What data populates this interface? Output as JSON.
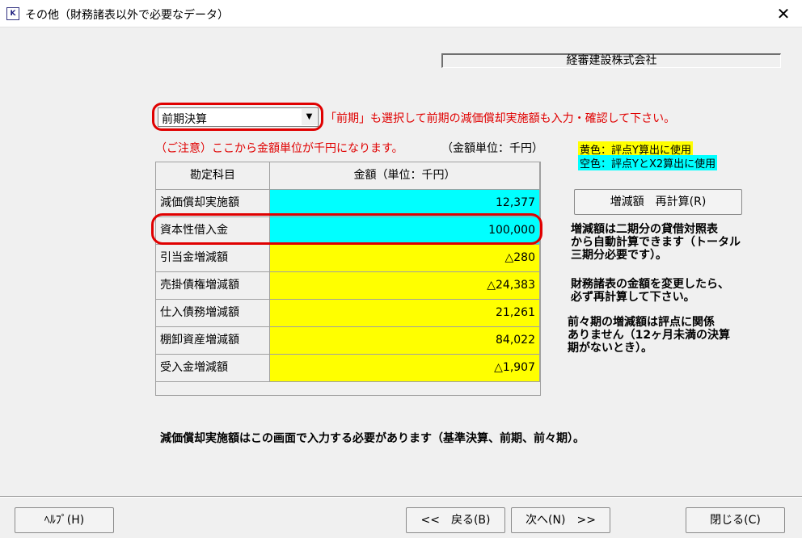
{
  "window": {
    "title": "その他（財務諸表以外で必要なデータ）",
    "close_label": "✕"
  },
  "company_name": "経審建設株式会社",
  "period_select": {
    "value": "前期決算"
  },
  "notice": "「前期」も選択して前期の減価償却実施額も入力・確認して下さい。",
  "caution": "（ご注意）ここから金額単位が千円になります。",
  "unit_label": "（金額単位：千円）",
  "legend": {
    "yellow": "黄色：評点Y算出に使用",
    "cyan": "空色：評点YとX2算出に使用"
  },
  "table": {
    "headers": [
      "勘定科目",
      "金額（単位：千円）"
    ],
    "rows": [
      {
        "label": "減価償却実施額",
        "value": "12,377",
        "color": "#00ffff"
      },
      {
        "label": "資本性借入金",
        "value": "100,000",
        "color": "#00ffff"
      },
      {
        "label": "引当金増減額",
        "value": "△280",
        "color": "#ffff00"
      },
      {
        "label": "売掛債権増減額",
        "value": "△24,383",
        "color": "#ffff00"
      },
      {
        "label": "仕入債務増減額",
        "value": "21,261",
        "color": "#ffff00"
      },
      {
        "label": "棚卸資産増減額",
        "value": "84,022",
        "color": "#ffff00"
      },
      {
        "label": "受入金増減額",
        "value": "△1,907",
        "color": "#ffff00"
      }
    ]
  },
  "recalc_button": "増減額　再計算(R)",
  "help": {
    "p1": [
      "増減額は二期分の貸借対照表",
      "から自動計算できます（トータル",
      "三期分必要です）。"
    ],
    "p2": [
      "財務諸表の金額を変更したら、",
      "必ず再計算して下さい。"
    ],
    "p3": [
      "前々期の増減額は評点に関係",
      "ありません（12ヶ月未満の決算",
      "期がないとき）。"
    ]
  },
  "bottom_note": "減価償却実施額はこの画面で入力する必要があります（基準決算、前期、前々期）。",
  "footer": {
    "help": "ﾍﾙﾌﾟ(H)",
    "back": "<<　戻る(B)",
    "next": "次へ(N)　>>",
    "close": "閉じる(C)"
  }
}
